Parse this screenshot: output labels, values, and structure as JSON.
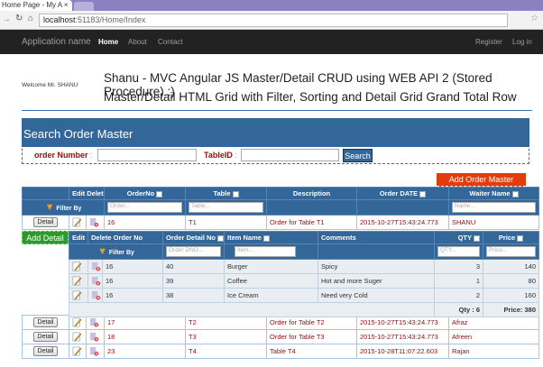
{
  "browser": {
    "tab_title": "Home Page - My A",
    "url_host": "localhost",
    "url_path": ":51183/Home/Index"
  },
  "navbar": {
    "brand": "Application name",
    "links": [
      "Home",
      "About",
      "Contact"
    ],
    "right": [
      "Register",
      "Log in"
    ]
  },
  "welcome": "Welcome Mr. SHANU",
  "title1": "Shanu - MVC Angular JS Master/Detail CRUD using WEB API 2 (Stored Procedure) :)",
  "title2": "Master/Detail HTML Grid with Filter, Sorting and Detail Grid Grand Total Row",
  "search": {
    "heading": "Search Order Master",
    "order_label": "order Number",
    "table_label": "TableID",
    "sep": ":",
    "button": "Search"
  },
  "add_master": "Add Order Master",
  "master": {
    "headers": {
      "edit": "Edit",
      "delete": "Delete",
      "orderno": "OrderNo",
      "table": "Table",
      "description": "Description",
      "date": "Order DATE",
      "waiter": "Waiter Name"
    },
    "filter_label": "Filter By",
    "ph_order": "Order...",
    "ph_table": "Table...",
    "ph_name": "Name...",
    "detail_btn": "Detail",
    "rows": [
      {
        "orderno": "16",
        "table": "T1",
        "description": "Order for Table T1",
        "date": "2015-10-27T15:43:24.773",
        "waiter": "SHANU"
      },
      {
        "orderno": "17",
        "table": "T2",
        "description": "Order for Table T2",
        "date": "2015-10-27T15:43:24.773",
        "waiter": "Afraz"
      },
      {
        "orderno": "18",
        "table": "T3",
        "description": "Order for Table T3",
        "date": "2015-10-27T15:43:24.773",
        "waiter": "Afreen"
      },
      {
        "orderno": "23",
        "table": "T4",
        "description": "Table T4",
        "date": "2015-10-28T11:07:22.603",
        "waiter": "Rajan"
      }
    ]
  },
  "detail": {
    "add_button": "Add Detail",
    "headers": {
      "edit": "Edit",
      "delete": "Delete",
      "orderno": "Order No",
      "odno": "Order Detail No",
      "item": "Item Name",
      "comments": "Comments",
      "qty": "QTY",
      "price": "Price"
    },
    "filter_label": "Filter By",
    "ph_odno": "Order DNO...",
    "ph_item": "Item...",
    "ph_qty": "QTY...",
    "ph_price": "Price...",
    "rows": [
      {
        "orderno": "16",
        "odno": "40",
        "item": "Burger",
        "comments": "Spicy",
        "qty": "3",
        "price": "140"
      },
      {
        "orderno": "16",
        "odno": "39",
        "item": "Coffee",
        "comments": "Hot and more Suger",
        "qty": "1",
        "price": "80"
      },
      {
        "orderno": "16",
        "odno": "38",
        "item": "Ice Cream",
        "comments": "Need very Cold",
        "qty": "2",
        "price": "160"
      }
    ],
    "total_qty": "Qty : 6",
    "total_price": "Price: 380"
  }
}
